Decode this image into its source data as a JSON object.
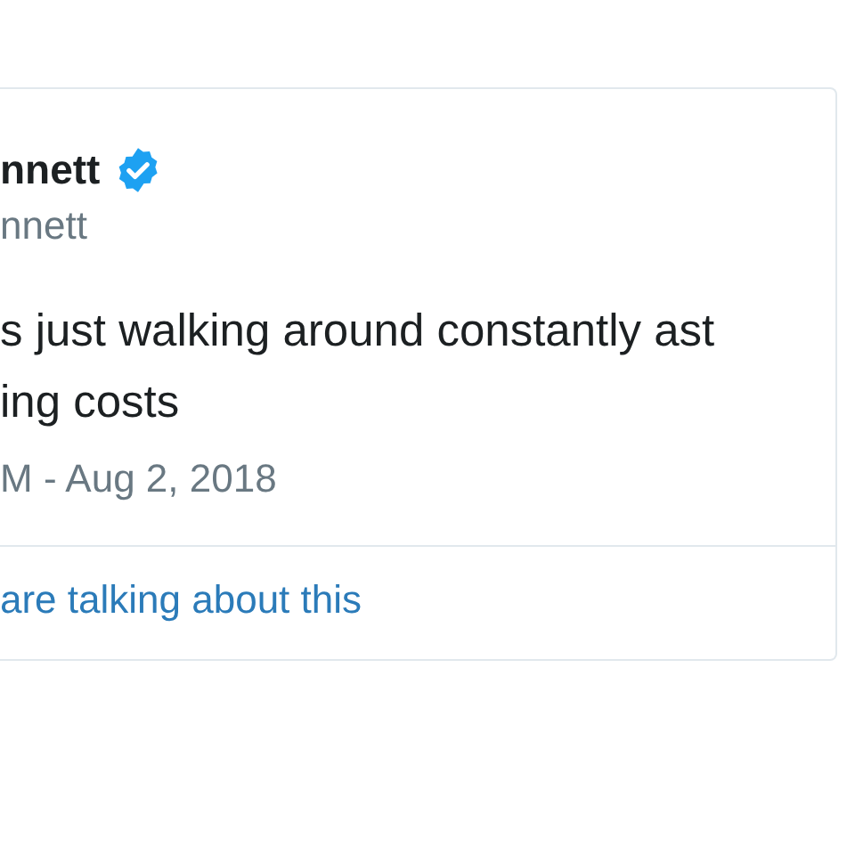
{
  "tweet": {
    "name": "nnett",
    "verified": true,
    "handle": "nnett",
    "text_lines": [
      "s just walking around constantly ast",
      "ing costs"
    ],
    "timestamp": "M - Aug 2, 2018",
    "talking_link": "are talking about this"
  }
}
